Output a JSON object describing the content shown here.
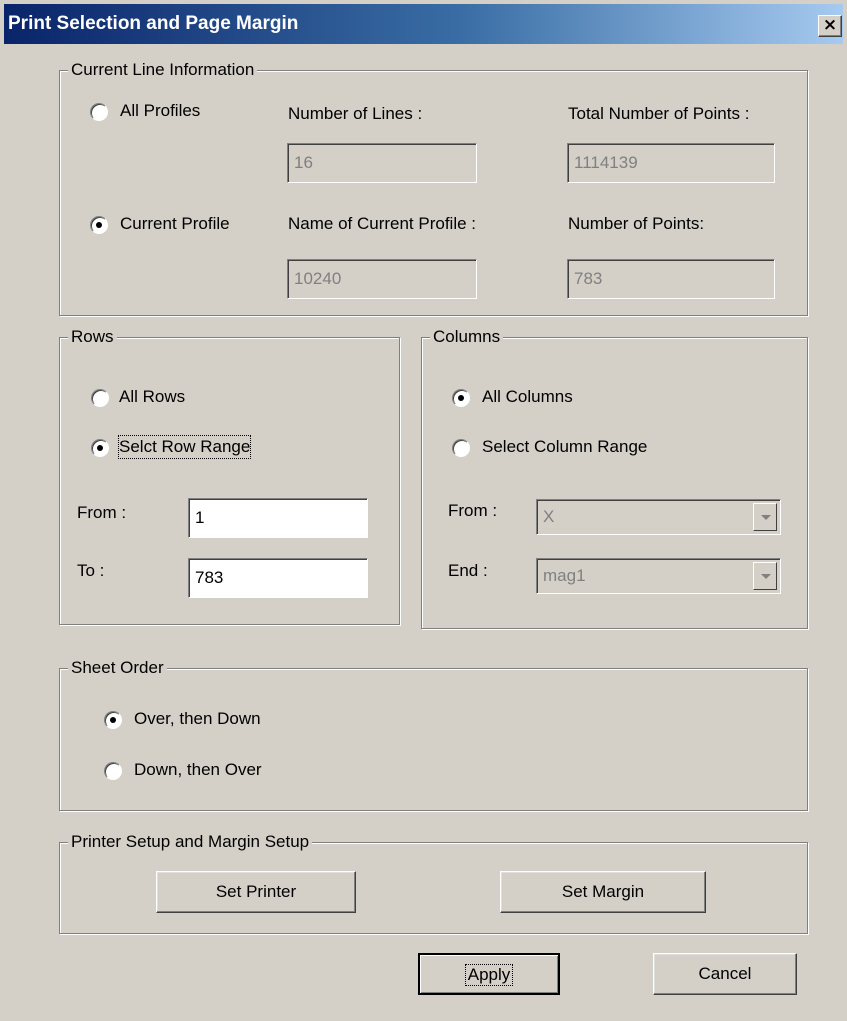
{
  "window": {
    "title": "Print Selection and Page Margin",
    "close_glyph": "×"
  },
  "current_line": {
    "legend": "Current Line Information",
    "all_profiles_label": "All Profiles",
    "current_profile_label": "Current Profile",
    "num_lines_label": "Number of Lines :",
    "num_lines_value": "16",
    "total_points_label": "Total Number of Points :",
    "total_points_value": "1114139",
    "profile_name_label": "Name of Current Profile :",
    "profile_name_value": "10240",
    "num_points_label": "Number of Points:",
    "num_points_value": "783",
    "selected": "current_profile"
  },
  "rows": {
    "legend": "Rows",
    "all_rows_label": "All Rows",
    "range_label": "Selct Row Range",
    "from_label": "From :",
    "from_value": "1",
    "to_label": "To :",
    "to_value": "783",
    "selected": "range"
  },
  "columns": {
    "legend": "Columns",
    "all_columns_label": "All Columns",
    "range_label": "Select Column Range",
    "from_label": "From :",
    "from_value": "X",
    "end_label": "End :",
    "end_value": "mag1",
    "selected": "all"
  },
  "sheet_order": {
    "legend": "Sheet Order",
    "over_down_label": "Over, then Down",
    "down_over_label": "Down, then Over",
    "selected": "over_down"
  },
  "printer_setup": {
    "legend": "Printer Setup and Margin Setup",
    "set_printer_label": "Set Printer",
    "set_margin_label": "Set Margin"
  },
  "footer": {
    "apply_label": "Apply",
    "cancel_label": "Cancel"
  },
  "colors": {
    "face": "#d4d0c8",
    "title_start": "#0a246a",
    "title_end": "#a6caf0",
    "title_text": "#ffffff"
  },
  "icons": {
    "close": "close-icon",
    "dropdown": "chevron-down-icon"
  }
}
